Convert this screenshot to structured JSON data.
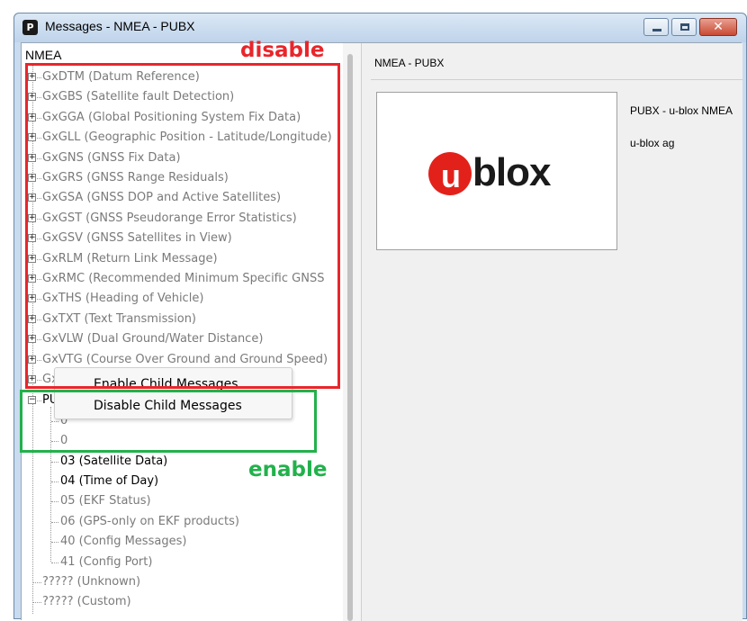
{
  "window": {
    "title": "Messages - NMEA - PUBX",
    "app_icon_glyph": "P"
  },
  "tree": {
    "root_label": "NMEA",
    "nmea_items": [
      {
        "expander": "+",
        "label": "GxDTM (Datum Reference)"
      },
      {
        "expander": "+",
        "label": "GxGBS (Satellite fault Detection)"
      },
      {
        "expander": "+",
        "label": "GxGGA (Global Positioning System Fix Data)"
      },
      {
        "expander": "+",
        "label": "GxGLL (Geographic Position - Latitude/Longitude)"
      },
      {
        "expander": "+",
        "label": "GxGNS (GNSS Fix Data)"
      },
      {
        "expander": "+",
        "label": "GxGRS (GNSS Range Residuals)"
      },
      {
        "expander": "+",
        "label": "GxGSA (GNSS DOP and Active Satellites)"
      },
      {
        "expander": "+",
        "label": "GxGST (GNSS Pseudorange Error Statistics)"
      },
      {
        "expander": "+",
        "label": "GxGSV (GNSS Satellites in View)"
      },
      {
        "expander": "+",
        "label": "GxRLM (Return Link Message)"
      },
      {
        "expander": "+",
        "label": "GxRMC (Recommended Minimum Specific GNSS"
      },
      {
        "expander": "+",
        "label": "GxTHS (Heading of Vehicle)"
      },
      {
        "expander": "+",
        "label": "GxTXT (Text Transmission)"
      },
      {
        "expander": "+",
        "label": "GxVLW (Dual Ground/Water Distance)"
      },
      {
        "expander": "+",
        "label": "GxVTG (Course Over Ground and Ground Speed)"
      },
      {
        "expander": "+",
        "label": "GxZDA (Time & Date)"
      }
    ],
    "pubx": {
      "expander": "−",
      "label": "PUBX",
      "children": [
        {
          "label": "0"
        },
        {
          "label": "0"
        },
        {
          "label": "03 (Satellite Data)",
          "active": true
        },
        {
          "label": "04 (Time of Day)",
          "active": true
        },
        {
          "label": "05 (EKF Status)",
          "active": false
        },
        {
          "label": "06 (GPS-only on EKF products)",
          "active": false
        },
        {
          "label": "40 (Config Messages)",
          "active": false
        },
        {
          "label": "41 (Config Port)",
          "active": false
        }
      ]
    },
    "trailing_items": [
      {
        "label": "????? (Unknown)"
      },
      {
        "label": "????? (Custom)"
      }
    ]
  },
  "context_menu": {
    "items": [
      "Enable Child Messages",
      "Disable Child Messages"
    ]
  },
  "right_pane": {
    "header": "NMEA - PUBX",
    "logo_u": "u",
    "logo_rest": "blox",
    "info_lines": [
      "PUBX - u-blox NMEA",
      "u-blox ag"
    ]
  },
  "annotations": {
    "disable_label": "disable",
    "enable_label": "enable",
    "disable_color": "#e8262b",
    "enable_color": "#22b14c"
  },
  "colors": {
    "inactive_text": "#7a7a7a",
    "active_text": "#000000",
    "logo_red": "#e3211b"
  }
}
